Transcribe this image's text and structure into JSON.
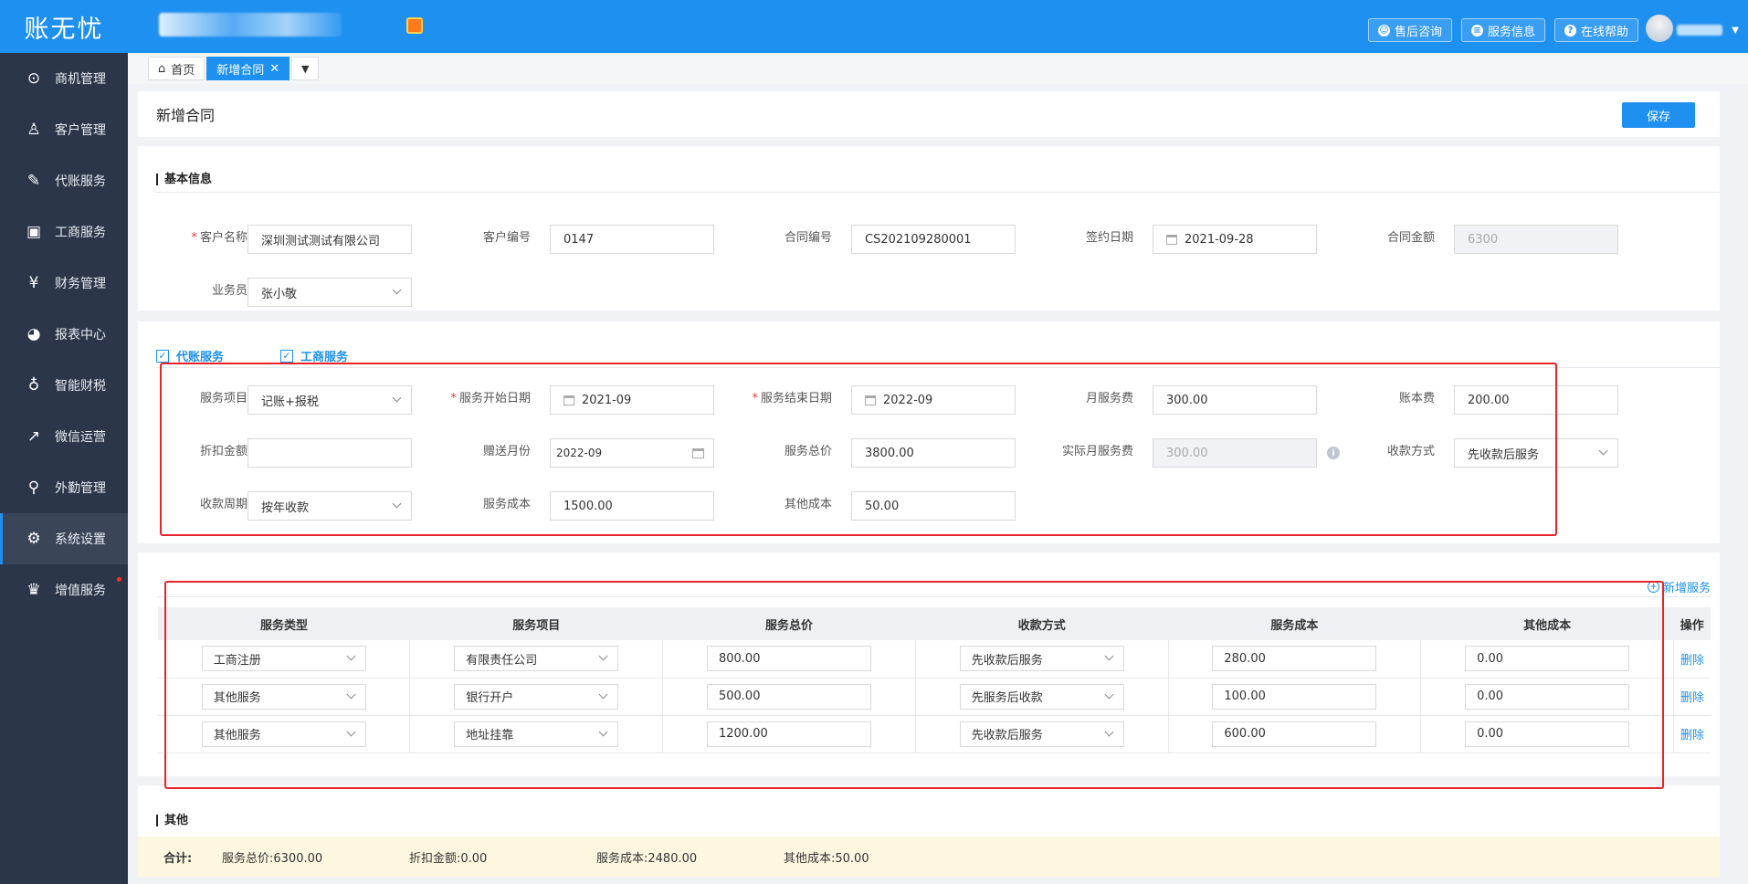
{
  "app": {
    "logo": "账无忧"
  },
  "sidebar": {
    "items": [
      {
        "label": "商机管理",
        "icon": "target-icon"
      },
      {
        "label": "客户管理",
        "icon": "customer-icon"
      },
      {
        "label": "代账服务",
        "icon": "pen-icon"
      },
      {
        "label": "工商服务",
        "icon": "briefcase-icon"
      },
      {
        "label": "财务管理",
        "icon": "yuan-icon"
      },
      {
        "label": "报表中心",
        "icon": "pie-chart-icon"
      },
      {
        "label": "智能财税",
        "icon": "moneybag-icon"
      },
      {
        "label": "微信运营",
        "icon": "trend-icon"
      },
      {
        "label": "外勤管理",
        "icon": "location-user-icon"
      },
      {
        "label": "系统设置",
        "icon": "gear-icon"
      },
      {
        "label": "增值服务",
        "icon": "crown-icon"
      }
    ]
  },
  "topbar": {
    "buttons": [
      "售后咨询",
      "服务信息",
      "在线帮助"
    ]
  },
  "tabs": {
    "home": "首页",
    "current": "新增合同"
  },
  "page": {
    "title": "新增合同",
    "save": "保存"
  },
  "basic": {
    "title": "基本信息",
    "customer_name_label": "客户名称",
    "customer_name": "深圳测试测试有限公司",
    "customer_no_label": "客户编号",
    "customer_no": "0147",
    "contract_no_label": "合同编号",
    "contract_no": "CS202109280001",
    "sign_date_label": "签约日期",
    "sign_date": "2021-09-28",
    "amount_label": "合同金额",
    "amount": "6300",
    "salesman_label": "业务员",
    "salesman": "张小敬"
  },
  "service": {
    "chk1": "代账服务",
    "chk2": "工商服务",
    "item_label": "服务项目",
    "item": "记账+报税",
    "start_label": "服务开始日期",
    "start": "2021-09",
    "end_label": "服务结束日期",
    "end": "2022-09",
    "monthly_fee_label": "月服务费",
    "monthly_fee": "300.00",
    "book_fee_label": "账本费",
    "book_fee": "200.00",
    "discount_label": "折扣金额",
    "discount": "",
    "gift_label": "赠送月份",
    "gift": "2022-09",
    "total_label": "服务总价",
    "total": "3800.00",
    "actual_label": "实际月服务费",
    "actual": "300.00",
    "pay_method_label": "收款方式",
    "pay_method": "先收款后服务",
    "cycle_label": "收款周期",
    "cycle": "按年收款",
    "cost_label": "服务成本",
    "cost": "1500.00",
    "other_cost_label": "其他成本",
    "other_cost": "50.00"
  },
  "extra": {
    "add": "新增服务",
    "headers": [
      "服务类型",
      "服务项目",
      "服务总价",
      "收款方式",
      "服务成本",
      "其他成本",
      "操作"
    ],
    "rows": [
      {
        "type": "工商注册",
        "item": "有限责任公司",
        "price": "800.00",
        "pay": "先收款后服务",
        "cost": "280.00",
        "other": "0.00",
        "action": "删除"
      },
      {
        "type": "其他服务",
        "item": "银行开户",
        "price": "500.00",
        "pay": "先服务后收款",
        "cost": "100.00",
        "other": "0.00",
        "action": "删除"
      },
      {
        "type": "其他服务",
        "item": "地址挂靠",
        "price": "1200.00",
        "pay": "先收款后服务",
        "cost": "600.00",
        "other": "0.00",
        "action": "删除"
      }
    ]
  },
  "other": {
    "title": "其他"
  },
  "totals": {
    "label": "合计:",
    "service_total": "服务总价:6300.00",
    "discount": "折扣金额:0.00",
    "cost": "服务成本:2480.00",
    "other_cost": "其他成本:50.00"
  }
}
